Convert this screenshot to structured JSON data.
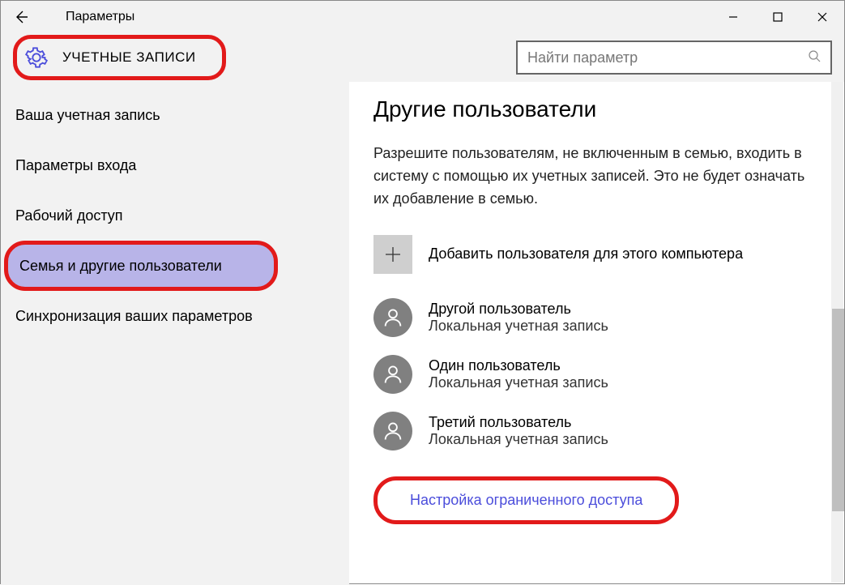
{
  "titlebar": {
    "title": "Параметры"
  },
  "header": {
    "section_label": "УЧЕТНЫЕ ЗАПИСИ"
  },
  "search": {
    "placeholder": "Найти параметр"
  },
  "sidebar": {
    "items": [
      {
        "label": "Ваша учетная запись"
      },
      {
        "label": "Параметры входа"
      },
      {
        "label": "Рабочий доступ"
      },
      {
        "label": "Семья и другие пользователи"
      },
      {
        "label": "Синхронизация ваших параметров"
      }
    ]
  },
  "main": {
    "heading": "Другие пользователи",
    "description": "Разрешите пользователям, не включенным в семью, входить в систему с помощью их учетных записей. Это не будет означать их добавление в семью.",
    "add_label": "Добавить пользователя для этого компьютера",
    "users": [
      {
        "name": "Другой пользователь",
        "sub": "Локальная учетная запись"
      },
      {
        "name": "Один пользователь",
        "sub": "Локальная учетная запись"
      },
      {
        "name": "Третий пользователь",
        "sub": "Локальная учетная запись"
      }
    ],
    "link": "Настройка ограниченного доступа"
  },
  "highlights": {
    "header_badge": true,
    "active_sidebar_index": 3,
    "bottom_link": true
  }
}
